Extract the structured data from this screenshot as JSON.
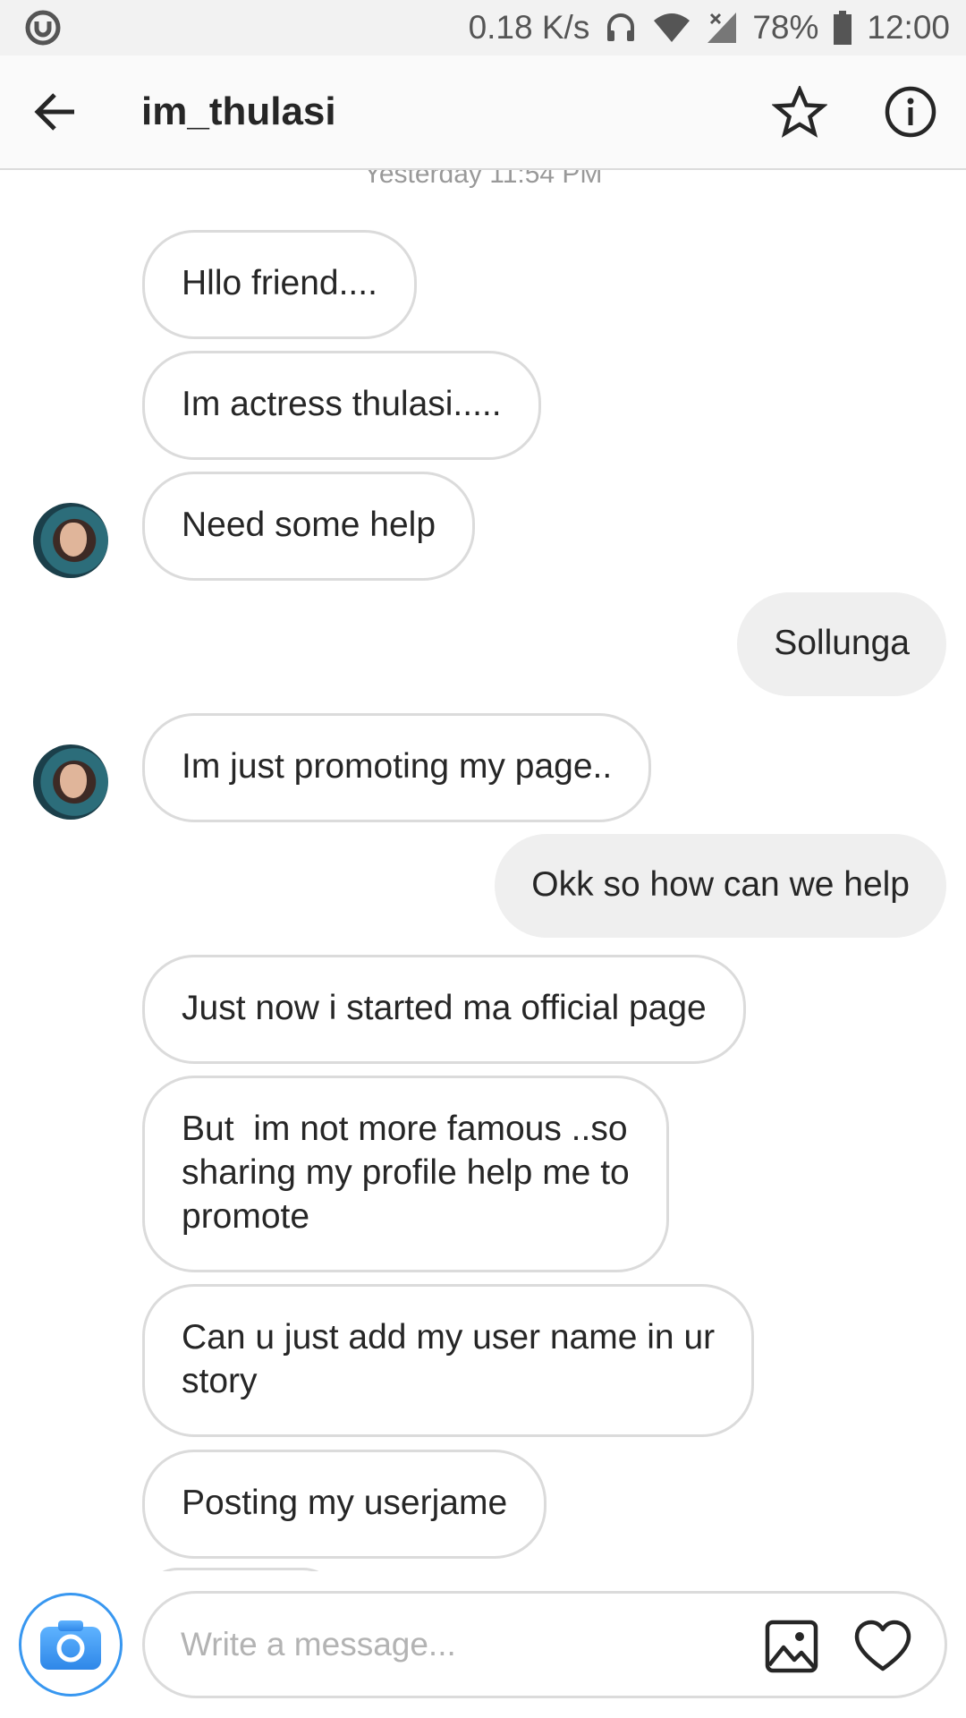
{
  "status_bar": {
    "speed": "0.18 K/s",
    "battery": "78%",
    "time": "12:00",
    "icons": [
      "app-notification-icon",
      "headphones-icon",
      "wifi-icon",
      "signal-icon",
      "battery-icon"
    ]
  },
  "header": {
    "title": "im_thulasi",
    "icons": [
      "back-arrow-icon",
      "star-icon",
      "info-icon"
    ]
  },
  "thread": {
    "timestamp": "Yesterday 11:54 PM",
    "messages": [
      {
        "from": "them",
        "text": "Hllo friend...."
      },
      {
        "from": "them",
        "text": "Im actress thulasi....."
      },
      {
        "from": "them",
        "text": "Need some help"
      },
      {
        "from": "me",
        "text": "Sollunga"
      },
      {
        "from": "them",
        "text": "Im just promoting my page.."
      },
      {
        "from": "me",
        "text": "Okk so how can we help"
      },
      {
        "from": "them",
        "text": "Just now i started ma official page"
      },
      {
        "from": "them",
        "text": "But  im not more famous ..so\nsharing my profile help me to\npromote"
      },
      {
        "from": "them",
        "text": "Can u just add my user name in ur\nstory"
      },
      {
        "from": "them",
        "text": "Posting my userjame"
      }
    ]
  },
  "composer": {
    "placeholder": "Write a message...",
    "value": "",
    "icons": [
      "camera-icon",
      "gallery-icon",
      "heart-icon"
    ]
  },
  "colors": {
    "accent": "#3897f0",
    "incoming_border": "#dbdbdb",
    "outgoing_bg": "#efefef"
  }
}
